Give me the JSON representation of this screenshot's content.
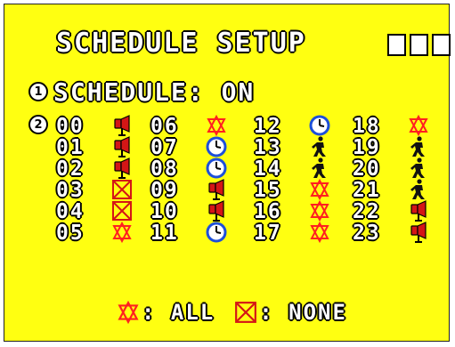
{
  "title": "SCHEDULE SETUP",
  "item1": {
    "number": "1",
    "label": "SCHEDULE: ON"
  },
  "item2": {
    "number": "2"
  },
  "schedule": [
    {
      "hour": "00",
      "mode": "alarm-speaker"
    },
    {
      "hour": "01",
      "mode": "alarm-speaker"
    },
    {
      "hour": "02",
      "mode": "alarm-speaker"
    },
    {
      "hour": "03",
      "mode": "none"
    },
    {
      "hour": "04",
      "mode": "none"
    },
    {
      "hour": "05",
      "mode": "all"
    },
    {
      "hour": "06",
      "mode": "all"
    },
    {
      "hour": "07",
      "mode": "timer"
    },
    {
      "hour": "08",
      "mode": "timer"
    },
    {
      "hour": "09",
      "mode": "alarm-speaker"
    },
    {
      "hour": "10",
      "mode": "alarm-speaker"
    },
    {
      "hour": "11",
      "mode": "timer"
    },
    {
      "hour": "12",
      "mode": "timer"
    },
    {
      "hour": "13",
      "mode": "motion"
    },
    {
      "hour": "14",
      "mode": "motion"
    },
    {
      "hour": "15",
      "mode": "all"
    },
    {
      "hour": "16",
      "mode": "all"
    },
    {
      "hour": "17",
      "mode": "all"
    },
    {
      "hour": "18",
      "mode": "all"
    },
    {
      "hour": "19",
      "mode": "motion"
    },
    {
      "hour": "20",
      "mode": "motion"
    },
    {
      "hour": "21",
      "mode": "motion"
    },
    {
      "hour": "22",
      "mode": "alarm-speaker"
    },
    {
      "hour": "23",
      "mode": "alarm-speaker"
    }
  ],
  "legend": {
    "all_label": ": ALL",
    "none_label": ": NONE"
  },
  "colors": {
    "background": "#ffff11",
    "alarm_red": "#d41616",
    "timer_blue": "#1d4fd9",
    "motion_black": "#111111",
    "all_star": "#ff2020"
  }
}
